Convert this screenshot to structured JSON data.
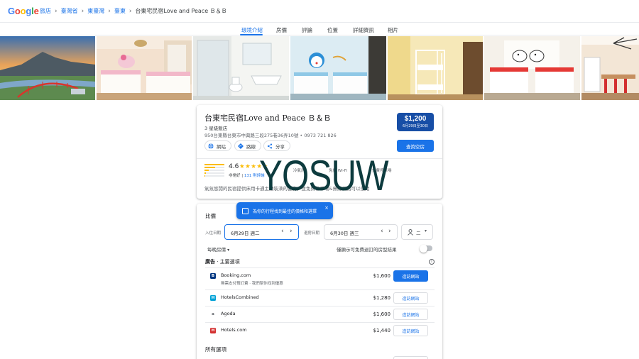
{
  "header": {
    "logo": "Google",
    "logo_colors": [
      "#4285f4",
      "#ea4335",
      "#fbbc05",
      "#4285f4",
      "#34a853",
      "#ea4335"
    ],
    "breadcrumbs": [
      "旅店",
      "臺灣省",
      "東臺灣",
      "臺東",
      "台東宅民宿Love and Peace Ｂ＆Ｂ"
    ]
  },
  "tabs": [
    "環境介紹",
    "房價",
    "評論",
    "位置",
    "詳細資訊",
    "相片"
  ],
  "active_tab": "環境介紹",
  "photos": [
    "photo-landscape-bridge",
    "photo-hello-kitty-room",
    "photo-bathroom",
    "photo-doraemon-room",
    "photo-bunk-bed-room",
    "photo-snoopy-room",
    "photo-kitchen-dining"
  ],
  "hotel": {
    "name": "台東宅民宿Love and Peace  Ｂ＆Ｂ",
    "class": "3 星級飯店",
    "address": "950台東縣台東市中興路三段275巷36弄10號 • 0973 721 826",
    "actions": {
      "website": "網站",
      "directions": "路線",
      "share": "分享"
    },
    "price": "$1,200",
    "price_dates": "6月29日至30日",
    "check_availability": "查詢空房",
    "rating": "4.6",
    "stars": "★★★★★",
    "rating_word": "非常好",
    "review_count": "131 則評論",
    "amenities": [
      "冷氣房",
      "免費 Wi-Fi",
      "免費停車場"
    ],
    "description": "氣氛悠閒的民宿提供床用卡通主題裝潢的套房，並免費停車場&無線網路可以使用"
  },
  "watermark": "YOSUW",
  "compare": {
    "title": "比價",
    "tooltip": "為你的行程找到最佳的價格和選擇",
    "checkin_label": "入住日期",
    "checkin_value": "6月29日 週二",
    "checkout_label": "退房日期",
    "checkout_value": "6月30日 週三",
    "guests_value": "二",
    "per_night": "每晚房價",
    "free_cancel": "僅顯示可免費退訂的房型結果",
    "ads_prefix": "廣告",
    "ads_title": "主要選項",
    "offers": [
      {
        "name": "Booking.com",
        "sub": "無需支付預訂費 · 我們幫你找到優惠",
        "price": "$1,600",
        "button": "造訪網站",
        "logo": "B",
        "color": "#003580"
      },
      {
        "name": "HotelsCombined",
        "sub": "",
        "price": "$1,280",
        "button": "造訪網站",
        "logo": "H",
        "color": "#00a1d6"
      },
      {
        "name": "Agoda",
        "sub": "",
        "price": "$1,600",
        "button": "造訪網站",
        "logo": "a",
        "color": "#5f6368"
      },
      {
        "name": "Hotels.com",
        "sub": "",
        "price": "$1,440",
        "button": "造訪網站",
        "logo": "H",
        "color": "#d32f2f"
      }
    ],
    "all_options": "所有選項"
  }
}
